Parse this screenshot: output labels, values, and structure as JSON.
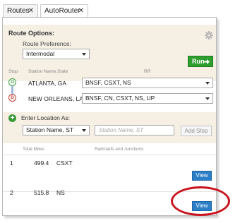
{
  "tabs": [
    {
      "label": "Routes",
      "close": "✕",
      "active": false
    },
    {
      "label": "AutoRouter",
      "close": "✕",
      "active": true
    }
  ],
  "route_options": {
    "title": "Route Options:",
    "preference_label": "Route Preference:",
    "preference_value": "Intermodal",
    "run_label": "Run"
  },
  "stops_table": {
    "headers": {
      "stop": "Stop",
      "station": "Station Name,State",
      "rr": "RR"
    },
    "rows": [
      {
        "marker": "O",
        "marker_color": "#3a9b3a",
        "location": "ATLANTA, GA",
        "railroads": "BNSF, CSXT, NS"
      },
      {
        "marker": "D",
        "marker_color": "#c0392b",
        "location": "NEW ORLEANS, LA",
        "railroads": "BNSF, CN, CSXT, NS, UP"
      }
    ]
  },
  "add_location": {
    "label": "Enter Location As:",
    "format_value": "Station Name, ST",
    "input_placeholder": "Station Name, ST",
    "add_button": "Add Stop"
  },
  "results": {
    "headers": {
      "total_miles": "Total Miles",
      "railroads": "Railroads and Junctions"
    },
    "rows": [
      {
        "index": "1",
        "miles": "499.4",
        "railroads": "CSXT",
        "view_label": "View"
      },
      {
        "index": "2",
        "miles": "515.8",
        "railroads": "NS",
        "view_label": "View"
      }
    ]
  },
  "colors": {
    "panel_bg": "#f5efe4",
    "run_green": "#2e9e2e",
    "view_blue": "#2c7fc7",
    "highlight_red": "#c9141e"
  },
  "icons": [
    "close-icon",
    "gear-icon",
    "arrow-right-icon",
    "plus-icon",
    "chevron-down-icon"
  ]
}
